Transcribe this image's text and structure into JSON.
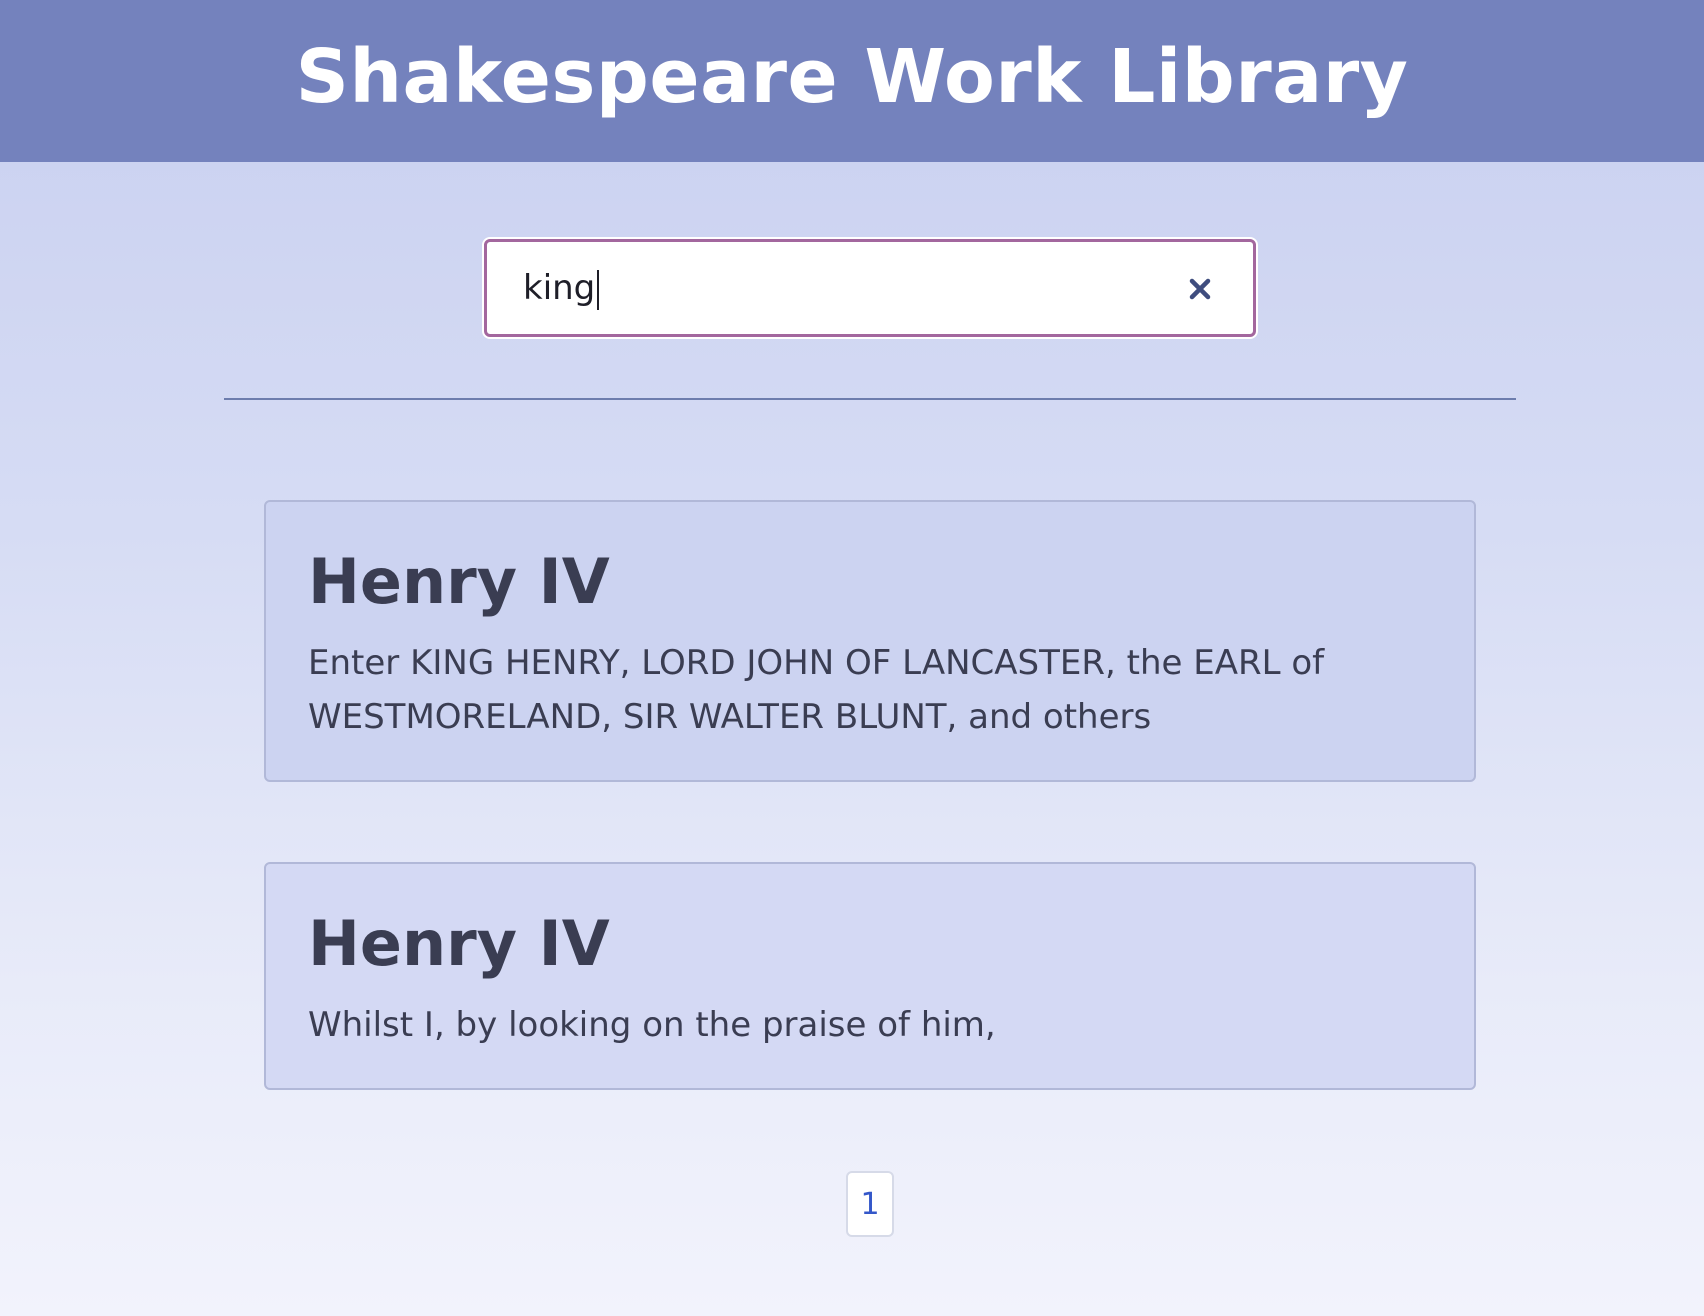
{
  "header": {
    "title": "Shakespeare Work Library"
  },
  "search": {
    "value": "king",
    "clear_icon": "close-icon"
  },
  "results": [
    {
      "title": "Henry IV",
      "text": "Enter KING HENRY, LORD JOHN OF LANCASTER, the EARL of WESTMORELAND, SIR WALTER BLUNT, and others"
    },
    {
      "title": "Henry IV",
      "text": "Whilst I, by looking on the praise of him,"
    }
  ],
  "pagination": {
    "current_page": "1"
  },
  "colors": {
    "header_bg": "#7482bd",
    "search_border": "#a3679e",
    "page_link": "#3457c9",
    "text": "#3a3d52"
  }
}
